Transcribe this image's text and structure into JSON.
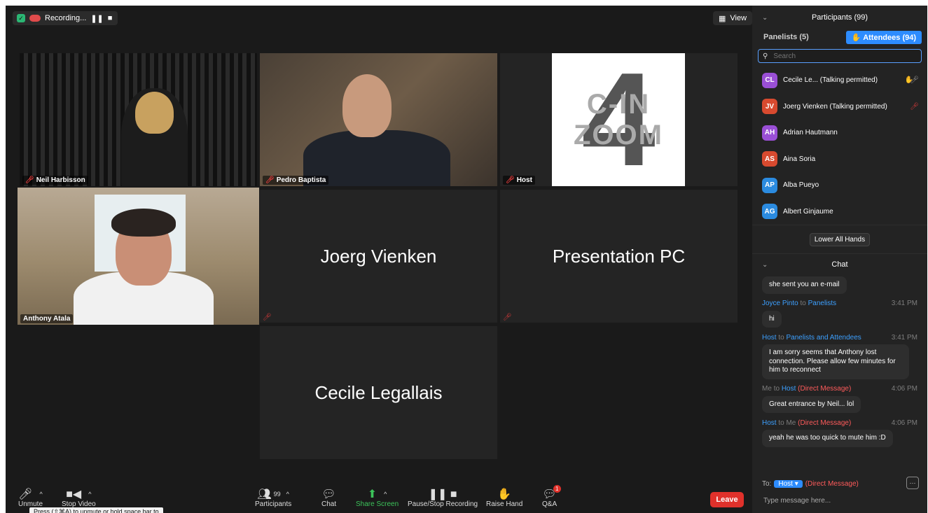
{
  "top": {
    "recording_label": "Recording...",
    "view_label": "View"
  },
  "tiles": {
    "neil": {
      "name": "Neil Harbisson"
    },
    "pedro": {
      "name": "Pedro Baptista"
    },
    "host": {
      "name": "Host",
      "logo_text_1": "C-IN",
      "logo_text_2": "ZOOM",
      "logo_number": "4"
    },
    "anthony": {
      "name": "Anthony Atala"
    },
    "joerg": {
      "name": "Joerg Vienken"
    },
    "presentation": {
      "name": "Presentation PC"
    },
    "cecile": {
      "name": "Cecile Legallais"
    }
  },
  "toolbar": {
    "unmute": "Unmute",
    "stop_video": "Stop Video",
    "participants": "Participants",
    "participants_count": "99",
    "chat": "Chat",
    "share_screen": "Share Screen",
    "pause_stop_recording": "Pause/Stop Recording",
    "raise_hand": "Raise Hand",
    "qa": "Q&A",
    "qa_badge": "1",
    "leave": "Leave",
    "tooltip": "Press (⇧⌘A) to unmute or hold space bar to"
  },
  "participants_panel": {
    "title": "Participants (99)",
    "tab_panelists": "Panelists (5)",
    "tab_attendees": "Attendees (94)",
    "search_placeholder": "Search",
    "people": [
      {
        "initials": "CL",
        "name": "Cecile Le...  (Talking permitted)",
        "color": "#9a4fd6"
      },
      {
        "initials": "JV",
        "name": "Joerg Vienken (Talking permitted)",
        "color": "#d84a2f"
      },
      {
        "initials": "AH",
        "name": "Adrian Hautmann",
        "color": "#9a4fd6"
      },
      {
        "initials": "AS",
        "name": "Aina Soria",
        "color": "#d84a2f"
      },
      {
        "initials": "AP",
        "name": "Alba Pueyo",
        "color": "#2b8be0"
      },
      {
        "initials": "AG",
        "name": "Albert Ginjaume",
        "color": "#2b8be0"
      }
    ],
    "lower_all_hands": "Lower All Hands"
  },
  "chat_panel": {
    "title": "Chat",
    "msg0": {
      "text": "she sent you an e-mail"
    },
    "msg1": {
      "from": "Joyce Pinto",
      "to_word": "to",
      "to": "Panelists",
      "time": "3:41 PM",
      "text": "hi"
    },
    "msg2": {
      "from": "Host",
      "to_word": "to",
      "to": "Panelists and Attendees",
      "time": "3:41 PM",
      "text": "I am sorry seems that Anthony lost connection. Please allow few minutes for him to reconnect"
    },
    "msg3": {
      "from": "Me",
      "to_word": "to",
      "to": "Host",
      "dm": "(Direct Message)",
      "time": "4:06 PM",
      "text": "Great entrance by Neil... lol"
    },
    "msg4": {
      "from": "Host",
      "to_word": "to",
      "to": "Me",
      "dm": "(Direct Message)",
      "time": "4:06 PM",
      "text": "yeah he was too quick to mute him :D"
    },
    "to_label": "To:",
    "to_value": "Host",
    "to_dm": "(Direct Message)",
    "input_placeholder": "Type message here..."
  }
}
